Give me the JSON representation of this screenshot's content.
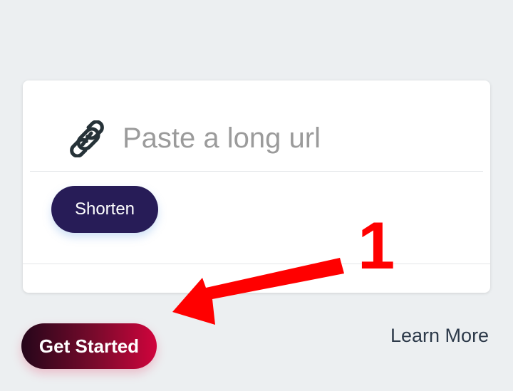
{
  "shortener": {
    "url_placeholder": "Paste a long url",
    "url_value": "",
    "shorten_label": "Shorten",
    "link_icon": "link-icon"
  },
  "cta": {
    "get_started_label": "Get Started",
    "learn_more_label": "Learn More"
  },
  "annotation": {
    "number": "1",
    "color": "#ff0000",
    "arrow_icon": "arrow-left-down-icon"
  },
  "colors": {
    "background": "#eceff1",
    "shorten_button": "#271c57",
    "get_started_gradient_start": "#25061a",
    "get_started_gradient_end": "#d0043c",
    "learn_more_text": "#2d3a4a"
  }
}
